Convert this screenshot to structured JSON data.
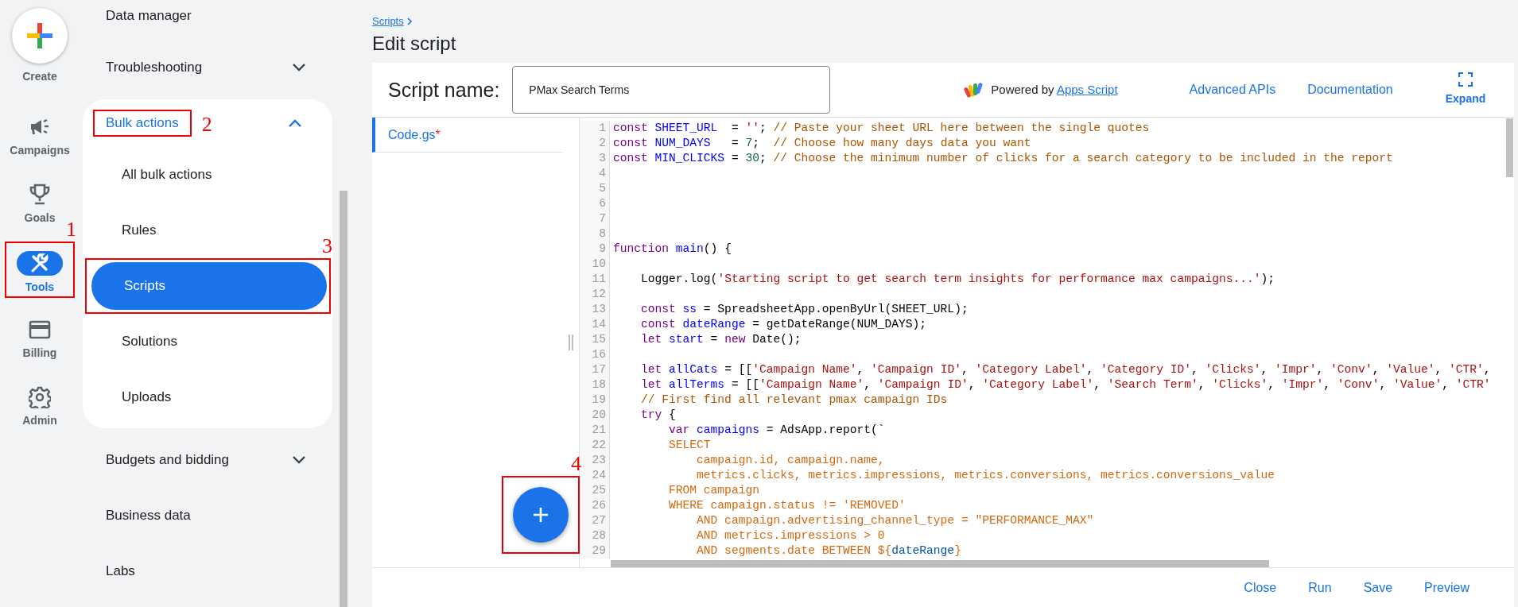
{
  "nav_rail": {
    "create_label": "Create",
    "items": [
      {
        "label": "Campaigns",
        "selected": false
      },
      {
        "label": "Goals",
        "selected": false
      },
      {
        "label": "Tools",
        "selected": true,
        "annotation": "1"
      },
      {
        "label": "Billing",
        "selected": false
      },
      {
        "label": "Admin",
        "selected": false
      }
    ]
  },
  "sidebar": {
    "items": [
      {
        "label": "Data manager"
      },
      {
        "label": "Troubleshooting",
        "expanded": false
      },
      {
        "label": "Bulk actions",
        "expanded": true,
        "annotation": "2",
        "children": [
          {
            "label": "All bulk actions",
            "selected": false
          },
          {
            "label": "Rules",
            "selected": false
          },
          {
            "label": "Scripts",
            "selected": true,
            "annotation": "3"
          },
          {
            "label": "Solutions",
            "selected": false
          },
          {
            "label": "Uploads",
            "selected": false
          }
        ]
      },
      {
        "label": "Budgets and bidding",
        "expanded": false
      },
      {
        "label": "Business data"
      },
      {
        "label": "Labs"
      }
    ]
  },
  "breadcrumb": "Scripts",
  "title": "Edit script",
  "editor": {
    "name_label": "Script name:",
    "name_value": "PMax Search Terms",
    "powered_by": "Powered by",
    "apps_script_link": "Apps Script",
    "links": [
      "Advanced APIs",
      "Documentation"
    ],
    "expand_label": "Expand",
    "files": [
      {
        "name": "Code.gs",
        "modified_mark": "*",
        "selected": true
      }
    ],
    "code_lines": [
      {
        "number": "1",
        "tokens": [
          {
            "text": "const ",
            "kind": "keyword"
          },
          {
            "text": "SHEET_URL",
            "kind": "def"
          },
          {
            "text": "  = ",
            "kind": "plain"
          },
          {
            "text": "''",
            "kind": "string"
          },
          {
            "text": "; ",
            "kind": "plain"
          },
          {
            "text": "// Paste your sheet URL here between the single quotes",
            "kind": "comment"
          }
        ]
      },
      {
        "number": "2",
        "tokens": [
          {
            "text": "const ",
            "kind": "keyword"
          },
          {
            "text": "NUM_DAYS",
            "kind": "def"
          },
          {
            "text": "   = ",
            "kind": "plain"
          },
          {
            "text": "7",
            "kind": "number"
          },
          {
            "text": ";  ",
            "kind": "plain"
          },
          {
            "text": "// Choose how many days data you want",
            "kind": "comment"
          }
        ]
      },
      {
        "number": "3",
        "tokens": [
          {
            "text": "const ",
            "kind": "keyword"
          },
          {
            "text": "MIN_CLICKS",
            "kind": "def"
          },
          {
            "text": " = ",
            "kind": "plain"
          },
          {
            "text": "30",
            "kind": "number"
          },
          {
            "text": "; ",
            "kind": "plain"
          },
          {
            "text": "// Choose the minimum number of clicks for a search category to be included in the report",
            "kind": "comment"
          }
        ]
      },
      {
        "number": "4"
      },
      {
        "number": "5"
      },
      {
        "number": "6"
      },
      {
        "number": "7"
      },
      {
        "number": "8"
      },
      {
        "number": "9",
        "tokens": [
          {
            "text": "function ",
            "kind": "keyword"
          },
          {
            "text": "main",
            "kind": "def"
          },
          {
            "text": "() {",
            "kind": "plain"
          }
        ]
      },
      {
        "number": "10"
      },
      {
        "number": "11",
        "tokens": [
          {
            "text": "    Logger.log(",
            "kind": "plain"
          },
          {
            "text": "'Starting script to get search term insights for performance max campaigns...'",
            "kind": "string"
          },
          {
            "text": ");",
            "kind": "plain"
          }
        ]
      },
      {
        "number": "12"
      },
      {
        "number": "13",
        "tokens": [
          {
            "text": "    const ",
            "kind": "keyword"
          },
          {
            "text": "ss",
            "kind": "def"
          },
          {
            "text": " = SpreadsheetApp.openByUrl(SHEET_URL);",
            "kind": "plain"
          }
        ]
      },
      {
        "number": "14",
        "tokens": [
          {
            "text": "    const ",
            "kind": "keyword"
          },
          {
            "text": "dateRange",
            "kind": "def"
          },
          {
            "text": " = getDateRange(NUM_DAYS);",
            "kind": "plain"
          }
        ]
      },
      {
        "number": "15",
        "tokens": [
          {
            "text": "    let ",
            "kind": "keyword"
          },
          {
            "text": "start",
            "kind": "def"
          },
          {
            "text": " = ",
            "kind": "plain"
          },
          {
            "text": "new",
            "kind": "keyword"
          },
          {
            "text": " Date();",
            "kind": "plain"
          }
        ]
      },
      {
        "number": "16"
      },
      {
        "number": "17",
        "tokens": [
          {
            "text": "    let ",
            "kind": "keyword"
          },
          {
            "text": "allCats",
            "kind": "def"
          },
          {
            "text": " = [[",
            "kind": "plain"
          },
          {
            "text": "'Campaign Name'",
            "kind": "string"
          },
          {
            "text": ", ",
            "kind": "plain"
          },
          {
            "text": "'Campaign ID'",
            "kind": "string"
          },
          {
            "text": ", ",
            "kind": "plain"
          },
          {
            "text": "'Category Label'",
            "kind": "string"
          },
          {
            "text": ", ",
            "kind": "plain"
          },
          {
            "text": "'Category ID'",
            "kind": "string"
          },
          {
            "text": ", ",
            "kind": "plain"
          },
          {
            "text": "'Clicks'",
            "kind": "string"
          },
          {
            "text": ", ",
            "kind": "plain"
          },
          {
            "text": "'Impr'",
            "kind": "string"
          },
          {
            "text": ", ",
            "kind": "plain"
          },
          {
            "text": "'Conv'",
            "kind": "string"
          },
          {
            "text": ", ",
            "kind": "plain"
          },
          {
            "text": "'Value'",
            "kind": "string"
          },
          {
            "text": ", ",
            "kind": "plain"
          },
          {
            "text": "'CTR'",
            "kind": "string"
          },
          {
            "text": ",",
            "kind": "plain"
          }
        ]
      },
      {
        "number": "18",
        "tokens": [
          {
            "text": "    let ",
            "kind": "keyword"
          },
          {
            "text": "allTerms",
            "kind": "def"
          },
          {
            "text": " = [[",
            "kind": "plain"
          },
          {
            "text": "'Campaign Name'",
            "kind": "string"
          },
          {
            "text": ", ",
            "kind": "plain"
          },
          {
            "text": "'Campaign ID'",
            "kind": "string"
          },
          {
            "text": ", ",
            "kind": "plain"
          },
          {
            "text": "'Category Label'",
            "kind": "string"
          },
          {
            "text": ", ",
            "kind": "plain"
          },
          {
            "text": "'Search Term'",
            "kind": "string"
          },
          {
            "text": ", ",
            "kind": "plain"
          },
          {
            "text": "'Clicks'",
            "kind": "string"
          },
          {
            "text": ", ",
            "kind": "plain"
          },
          {
            "text": "'Impr'",
            "kind": "string"
          },
          {
            "text": ", ",
            "kind": "plain"
          },
          {
            "text": "'Conv'",
            "kind": "string"
          },
          {
            "text": ", ",
            "kind": "plain"
          },
          {
            "text": "'Value'",
            "kind": "string"
          },
          {
            "text": ", ",
            "kind": "plain"
          },
          {
            "text": "'CTR'",
            "kind": "string"
          }
        ]
      },
      {
        "number": "19",
        "tokens": [
          {
            "text": "    // First find all relevant pmax campaign IDs",
            "kind": "comment"
          }
        ]
      },
      {
        "number": "20",
        "tokens": [
          {
            "text": "    try",
            "kind": "keyword"
          },
          {
            "text": " {",
            "kind": "plain"
          }
        ]
      },
      {
        "number": "21",
        "tokens": [
          {
            "text": "        var ",
            "kind": "keyword"
          },
          {
            "text": "campaigns",
            "kind": "def"
          },
          {
            "text": " = AdsApp.report(`",
            "kind": "plain"
          }
        ]
      },
      {
        "number": "22",
        "tokens": [
          {
            "text": "        SELECT",
            "kind": "template"
          }
        ]
      },
      {
        "number": "23",
        "tokens": [
          {
            "text": "            campaign.id, campaign.name,",
            "kind": "template"
          }
        ]
      },
      {
        "number": "24",
        "tokens": [
          {
            "text": "            metrics.clicks, metrics.impressions, metrics.conversions, metrics.conversions_value",
            "kind": "template"
          }
        ]
      },
      {
        "number": "25",
        "tokens": [
          {
            "text": "        FROM campaign",
            "kind": "template"
          }
        ]
      },
      {
        "number": "26",
        "tokens": [
          {
            "text": "        WHERE campaign.status != 'REMOVED'",
            "kind": "template"
          }
        ]
      },
      {
        "number": "27",
        "tokens": [
          {
            "text": "            AND campaign.advertising_channel_type = \"PERFORMANCE_MAX\"",
            "kind": "template"
          }
        ]
      },
      {
        "number": "28",
        "tokens": [
          {
            "text": "            AND metrics.impressions > 0",
            "kind": "template"
          }
        ]
      },
      {
        "number": "29",
        "tokens": [
          {
            "text": "            AND segments.date BETWEEN ${",
            "kind": "template"
          },
          {
            "text": "dateRange",
            "kind": "variable"
          },
          {
            "text": "}",
            "kind": "template"
          }
        ]
      }
    ],
    "fab_annotation": "4",
    "footer_buttons": [
      "Close",
      "Run",
      "Save",
      "Preview"
    ]
  }
}
